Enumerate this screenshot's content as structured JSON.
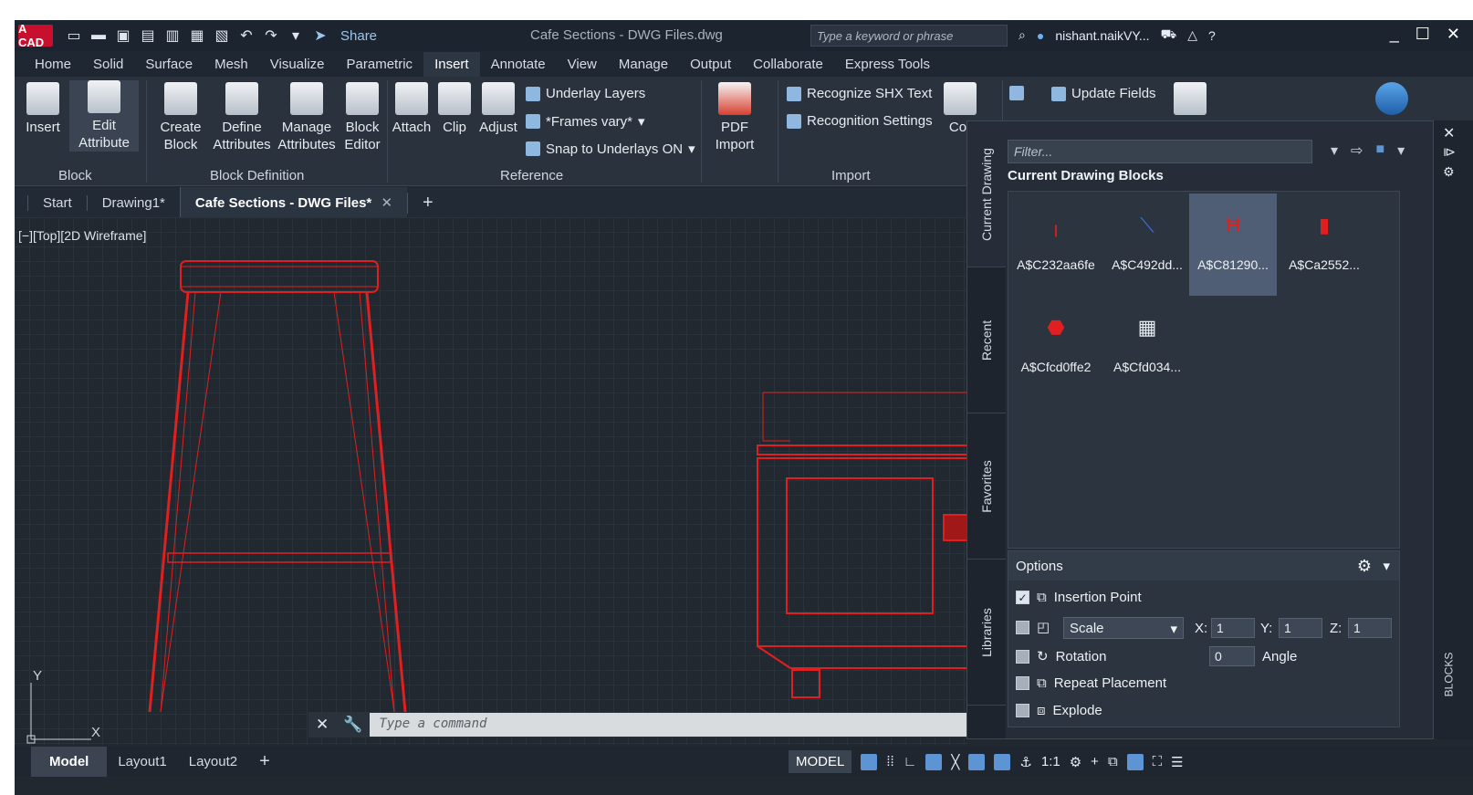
{
  "app": {
    "logo_text": "A CAD",
    "title": "Cafe Sections - DWG Files.dwg",
    "share_label": "Share",
    "search_placeholder": "Type a keyword or phrase",
    "user": "nishant.naikVY...",
    "accent": "#c8102e"
  },
  "menu_tabs": [
    "Home",
    "Solid",
    "Surface",
    "Mesh",
    "Visualize",
    "Parametric",
    "Insert",
    "Annotate",
    "View",
    "Manage",
    "Output",
    "Collaborate",
    "Express Tools"
  ],
  "active_tab": "Insert",
  "ribbon": {
    "insert": "Insert",
    "edit_attribute_1": "Edit",
    "edit_attribute_2": "Attribute",
    "create_block_1": "Create",
    "create_block_2": "Block",
    "define_attr_1": "Define",
    "define_attr_2": "Attributes",
    "manage_attr_1": "Manage",
    "manage_attr_2": "Attributes",
    "block_editor_1": "Block",
    "block_editor_2": "Editor",
    "attach": "Attach",
    "clip": "Clip",
    "adjust": "Adjust",
    "underlay_layers": "Underlay Layers",
    "frames_vary": "*Frames vary*",
    "snap_underlays": "Snap to Underlays ON",
    "pdf_import_1": "PDF",
    "pdf_import_2": "Import",
    "recognize_shx": "Recognize SHX Text",
    "recognition_settings": "Recognition Settings",
    "update_fields": "Update Fields",
    "cor": "Cor",
    "group_block": "Block",
    "group_block_def": "Block Definition",
    "group_reference": "Reference",
    "group_import": "Import"
  },
  "doc_tabs": [
    "Start",
    "Drawing1*",
    "Cafe Sections - DWG Files*"
  ],
  "viewport_label": "[−][Top][2D Wireframe]",
  "command_placeholder": "Type a command",
  "layout_tabs": [
    "Model",
    "Layout1",
    "Layout2"
  ],
  "status": {
    "model": "MODEL",
    "scale": "1:1"
  },
  "palette": {
    "vtabs": [
      "Current Drawing",
      "Recent",
      "Favorites",
      "Libraries"
    ],
    "filter_placeholder": "Filter...",
    "heading": "Current Drawing Blocks",
    "blocks": [
      "A$C232aa6fe",
      "A$C492dd...",
      "A$C81290...",
      "A$Ca2552...",
      "A$Cfcd0ffe2",
      "A$Cfd034..."
    ],
    "options_title": "Options",
    "insertion_point": "Insertion Point",
    "scale": "Scale",
    "x_label": "X:",
    "x_val": "1",
    "y_label": "Y:",
    "y_val": "1",
    "z_label": "Z:",
    "z_val": "1",
    "rotation": "Rotation",
    "angle_val": "0",
    "angle_label": "Angle",
    "repeat": "Repeat Placement",
    "explode": "Explode",
    "side_label": "BLOCKS"
  }
}
